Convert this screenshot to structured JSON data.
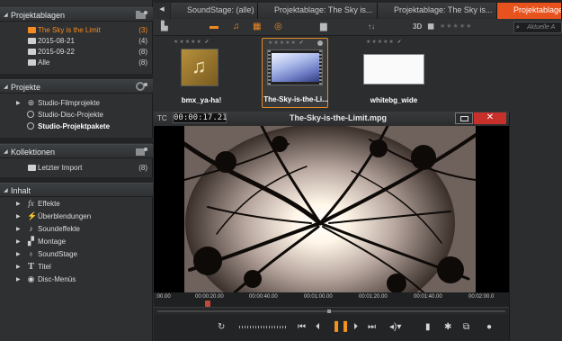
{
  "sidebar": {
    "sections": {
      "projektablagen": {
        "title": "Projektablagen",
        "items": [
          {
            "label": "The Sky is the Limit",
            "count": "(3)"
          },
          {
            "label": "2015-08-21",
            "count": "(4)"
          },
          {
            "label": "2015-09-22",
            "count": "(8)"
          },
          {
            "label": "Alle",
            "count": "(8)"
          }
        ]
      },
      "projekte": {
        "title": "Projekte",
        "items": [
          {
            "label": "Studio-Filmprojekte"
          },
          {
            "label": "Studio-Disc-Projekte"
          },
          {
            "label": "Studio-Projektpakete"
          }
        ]
      },
      "kollektionen": {
        "title": "Kollektionen",
        "items": [
          {
            "label": "Letzter Import",
            "count": "(8)"
          }
        ]
      },
      "inhalt": {
        "title": "Inhalt",
        "items": [
          {
            "label": "Effekte",
            "icon": "fx"
          },
          {
            "label": "Überblendungen",
            "icon": "⚡"
          },
          {
            "label": "Soundeffekte",
            "icon": "♪"
          },
          {
            "label": "Montage",
            "icon": "▞"
          },
          {
            "label": "SoundStage",
            "icon": "♁"
          },
          {
            "label": "Titel",
            "icon": "T"
          },
          {
            "label": "Disc-Menüs",
            "icon": "◉"
          }
        ]
      }
    }
  },
  "tabs": [
    {
      "label": "SoundStage: (alle)"
    },
    {
      "label": "Projektablage: The Sky is..."
    },
    {
      "label": "Projektablage: The Sky is..."
    },
    {
      "label": "Projektablage: T"
    }
  ],
  "toolbar": {
    "view_3d": "3D",
    "search_placeholder": "Aktuelle A"
  },
  "library": {
    "items": [
      {
        "caption": "bmx_ya-ha!"
      },
      {
        "caption": "The-Sky-is-the-Li..."
      },
      {
        "caption": "whitebg_wide"
      }
    ]
  },
  "player": {
    "tc_label": "TC",
    "timecode": "00:00:17.21",
    "title": "The-Sky-is-the-Limit.mpg",
    "close_label": "✕",
    "ruler_ticks": [
      ":00.00",
      "00:00:20.00",
      "00:00:40.00",
      "00:01:00.00",
      "00:01:20.00",
      "00:01:40.00",
      "00:02:00.0"
    ]
  }
}
